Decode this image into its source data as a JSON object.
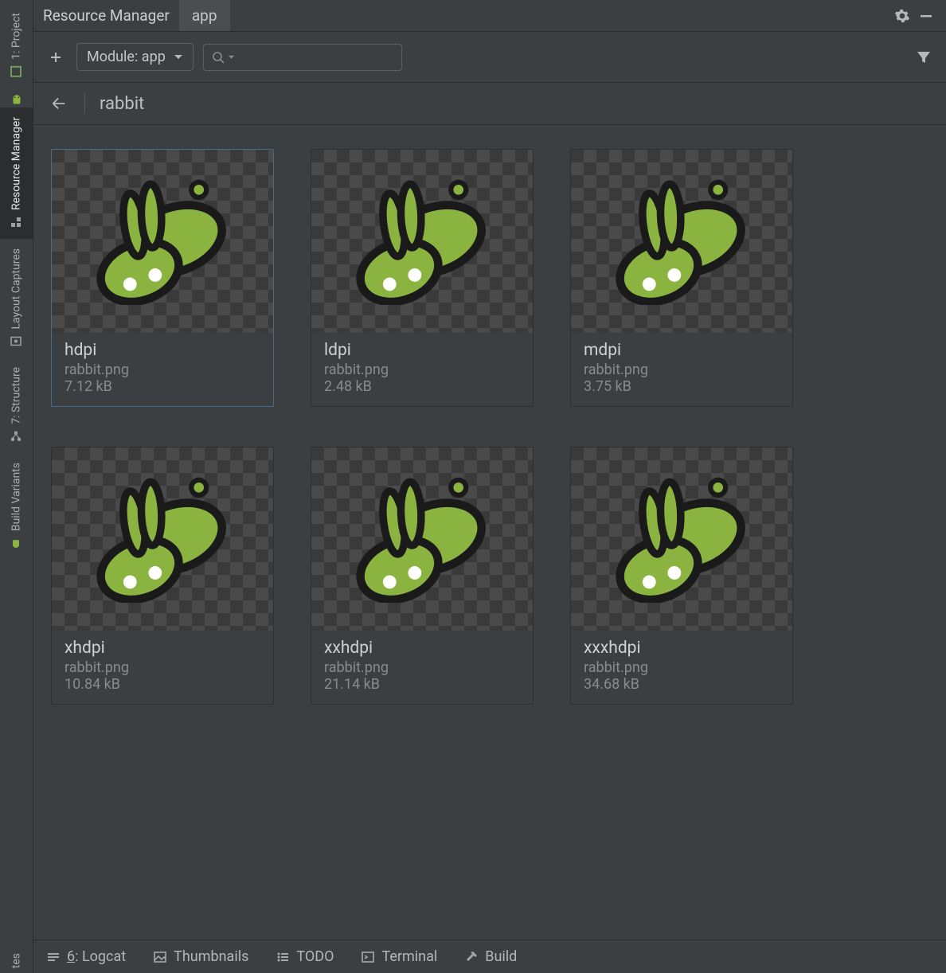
{
  "header": {
    "title": "Resource Manager",
    "tab": "app"
  },
  "toolbar": {
    "module_label": "Module: app",
    "search_value": ""
  },
  "breadcrumb": {
    "current": "rabbit"
  },
  "sidebar": {
    "items": [
      {
        "label": "1: Project",
        "icon": "project"
      },
      {
        "label": "Resource Manager",
        "icon": "resources",
        "active": true
      },
      {
        "label": "Layout Captures",
        "icon": "captures"
      },
      {
        "label": "7: Structure",
        "icon": "structure"
      },
      {
        "label": "Build Variants",
        "icon": "variants"
      }
    ]
  },
  "resources": [
    {
      "density": "hdpi",
      "filename": "rabbit.png",
      "size": "7.12 kB",
      "selected": true
    },
    {
      "density": "ldpi",
      "filename": "rabbit.png",
      "size": "2.48 kB",
      "selected": false
    },
    {
      "density": "mdpi",
      "filename": "rabbit.png",
      "size": "3.75 kB",
      "selected": false
    },
    {
      "density": "xhdpi",
      "filename": "rabbit.png",
      "size": "10.84 kB",
      "selected": false
    },
    {
      "density": "xxhdpi",
      "filename": "rabbit.png",
      "size": "21.14 kB",
      "selected": false
    },
    {
      "density": "xxxhdpi",
      "filename": "rabbit.png",
      "size": "34.68 kB",
      "selected": false
    }
  ],
  "bottombar": {
    "items": [
      {
        "label_prefix": "6",
        "label": ": Logcat",
        "icon": "logcat"
      },
      {
        "label": "Thumbnails",
        "icon": "image"
      },
      {
        "label": "TODO",
        "icon": "list"
      },
      {
        "label": "Terminal",
        "icon": "terminal"
      },
      {
        "label": "Build",
        "icon": "hammer"
      }
    ]
  }
}
